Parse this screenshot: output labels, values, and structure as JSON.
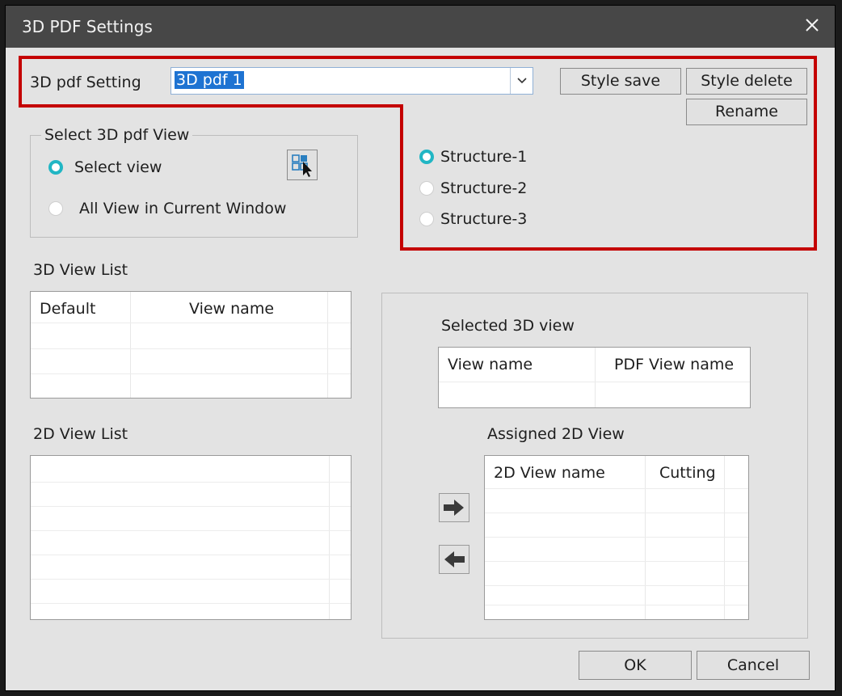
{
  "window": {
    "title": "3D PDF Settings"
  },
  "setting": {
    "label": "3D pdf Setting",
    "combo_value": "3D pdf  1",
    "style_save": "Style save",
    "style_delete": "Style delete",
    "rename": "Rename"
  },
  "select_view_group": {
    "title": "Select 3D pdf View",
    "option_select_view": "Select view",
    "option_all_view": "All View in Current Window",
    "selected": "select_view"
  },
  "structures": {
    "items": [
      "Structure-1",
      "Structure-2",
      "Structure-3"
    ],
    "selected": "Structure-1"
  },
  "view3d_list": {
    "label": "3D View List",
    "columns": [
      "Default",
      "View name"
    ]
  },
  "view2d_list": {
    "label": "2D View List"
  },
  "selected_3d": {
    "label": "Selected 3D view",
    "columns": [
      "View name",
      "PDF View name"
    ]
  },
  "assigned_2d": {
    "label": "Assigned 2D View",
    "columns": [
      "2D View name",
      "Cutting"
    ]
  },
  "footer": {
    "ok": "OK",
    "cancel": "Cancel"
  },
  "colors": {
    "highlight": "#c40000",
    "radio_checked": "#21b6c4",
    "title_bar": "#474747",
    "selection": "#1e73d2"
  },
  "icons": [
    "close-icon",
    "chevron-down-icon",
    "select-view-picker-icon",
    "arrow-right-icon",
    "arrow-left-icon"
  ]
}
